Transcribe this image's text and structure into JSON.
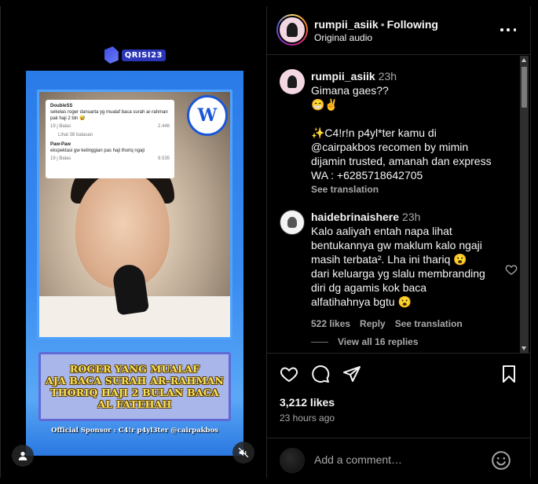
{
  "media": {
    "channel_logo_text": "QRISI23",
    "comment_card": {
      "user1": "DoubleSS",
      "text1": "sekelas roger danuarta yg mualaf baca surah ar-rahman pak haji 2 bln 😅",
      "meta1": "19 j  Balas",
      "likes1": "2.446",
      "view_replies": "Lihat 38 balasan",
      "user2": "Paw-Paw",
      "text2": "ekspektasi gw ketinggian pas haji thoriq ngaji",
      "meta2": "19 j  Balas",
      "likes2": "9.535"
    },
    "badge_letter": "W",
    "headline": [
      "ROGER YANG MUALAF",
      "AJA BACA SURAH AR-RAHMAN",
      "THORIQ HAJI 2 BULAN BACA",
      "AL FATEHAH"
    ],
    "sponsor": "Official Sponsor : C4!r p4yl3ter @cairpakbos"
  },
  "header": {
    "username": "rumpii_asiik",
    "dot": "•",
    "follow_label": "Following",
    "subtitle": "Original audio"
  },
  "comments": [
    {
      "username": "rumpii_asiik",
      "time": "23h",
      "text": "Gimana gaes??\n😁✌️\n\n✨C4!r!n p4yl*ter kamu di\n@cairpakbos recomen by mimin\ndijamin trusted, amanah dan express\nWA : +6285718642705",
      "see_translation": "See translation"
    },
    {
      "username": "haidebrinaishere",
      "time": "23h",
      "text": "Kalo aaliyah entah napa lihat\nbentukannya gw maklum kalo ngaji\nmasih terbata². Lha ini thariq 😮\ndari keluarga yg slalu membranding\ndiri dg agamis kok baca\nalfatihahnya bgtu 😮",
      "likes": "522 likes",
      "reply": "Reply",
      "see_translation": "See translation",
      "view_replies": "View all 16 replies"
    }
  ],
  "actions": {
    "likes": "3,212 likes",
    "posted": "23 hours ago"
  },
  "add_comment": {
    "placeholder": "Add a comment…"
  }
}
